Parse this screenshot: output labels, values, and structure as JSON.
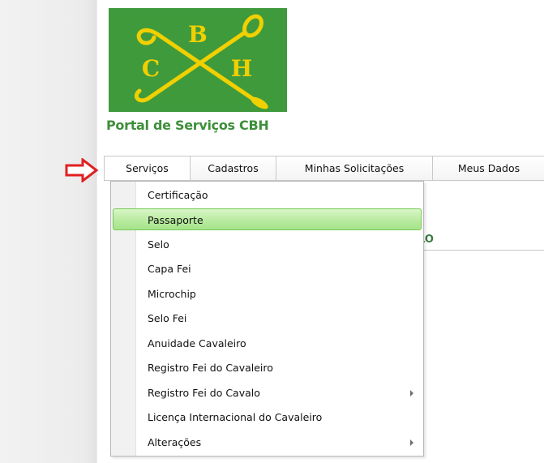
{
  "logo": {
    "letters": [
      "B",
      "C",
      "H"
    ],
    "background": "#3f9a3c",
    "emblem_color": "#f0d000",
    "letter_color": "#1a1a1a"
  },
  "portal_title": "Portal de Serviços CBH",
  "menubar": {
    "items": [
      "Serviços",
      "Cadastros",
      "Minhas Solicitações",
      "Meus Dados"
    ]
  },
  "dropdown": {
    "items": [
      {
        "label": "Certificação",
        "submenu": false
      },
      {
        "label": "Passaporte",
        "submenu": false,
        "highlighted": true
      },
      {
        "label": "Selo",
        "submenu": false
      },
      {
        "label": "Capa Fei",
        "submenu": false
      },
      {
        "label": "Microchip",
        "submenu": false
      },
      {
        "label": "Selo Fei",
        "submenu": false
      },
      {
        "label": "Anuidade Cavaleiro",
        "submenu": false
      },
      {
        "label": "Registro Fei do Cavaleiro",
        "submenu": false
      },
      {
        "label": "Registro Fei do Cavalo",
        "submenu": true
      },
      {
        "label": "Licença Internacional do Cavaleiro",
        "submenu": false
      },
      {
        "label": "Alterações",
        "submenu": true
      }
    ]
  },
  "background_heading": "LO",
  "colors": {
    "highlight": "#b8eba0",
    "pointer_arrow": "#e02020",
    "title_green": "#3d8f39"
  }
}
